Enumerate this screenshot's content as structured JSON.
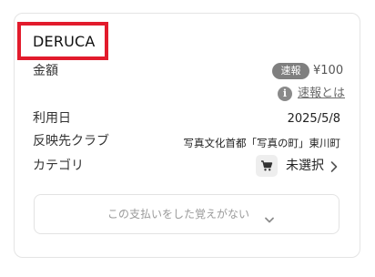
{
  "card": {
    "merchant": "DERUCA",
    "amount": {
      "label": "金額",
      "badge": "速報",
      "value": "¥100"
    },
    "info": {
      "icon": "info-icon",
      "link_label": "速報とは"
    },
    "date": {
      "label": "利用日",
      "value": "2025/5/8"
    },
    "club": {
      "label": "反映先クラブ",
      "value": "写真文化首都「写真の町」東川町"
    },
    "category": {
      "label": "カテゴリ",
      "icon": "cart-icon",
      "value": "未選択"
    },
    "dispute": {
      "label": "この支払いをした覚えがない"
    }
  },
  "colors": {
    "highlight": "#e21b2c",
    "badge_bg": "#7f7f7f",
    "card_border": "#e4e4e4"
  }
}
